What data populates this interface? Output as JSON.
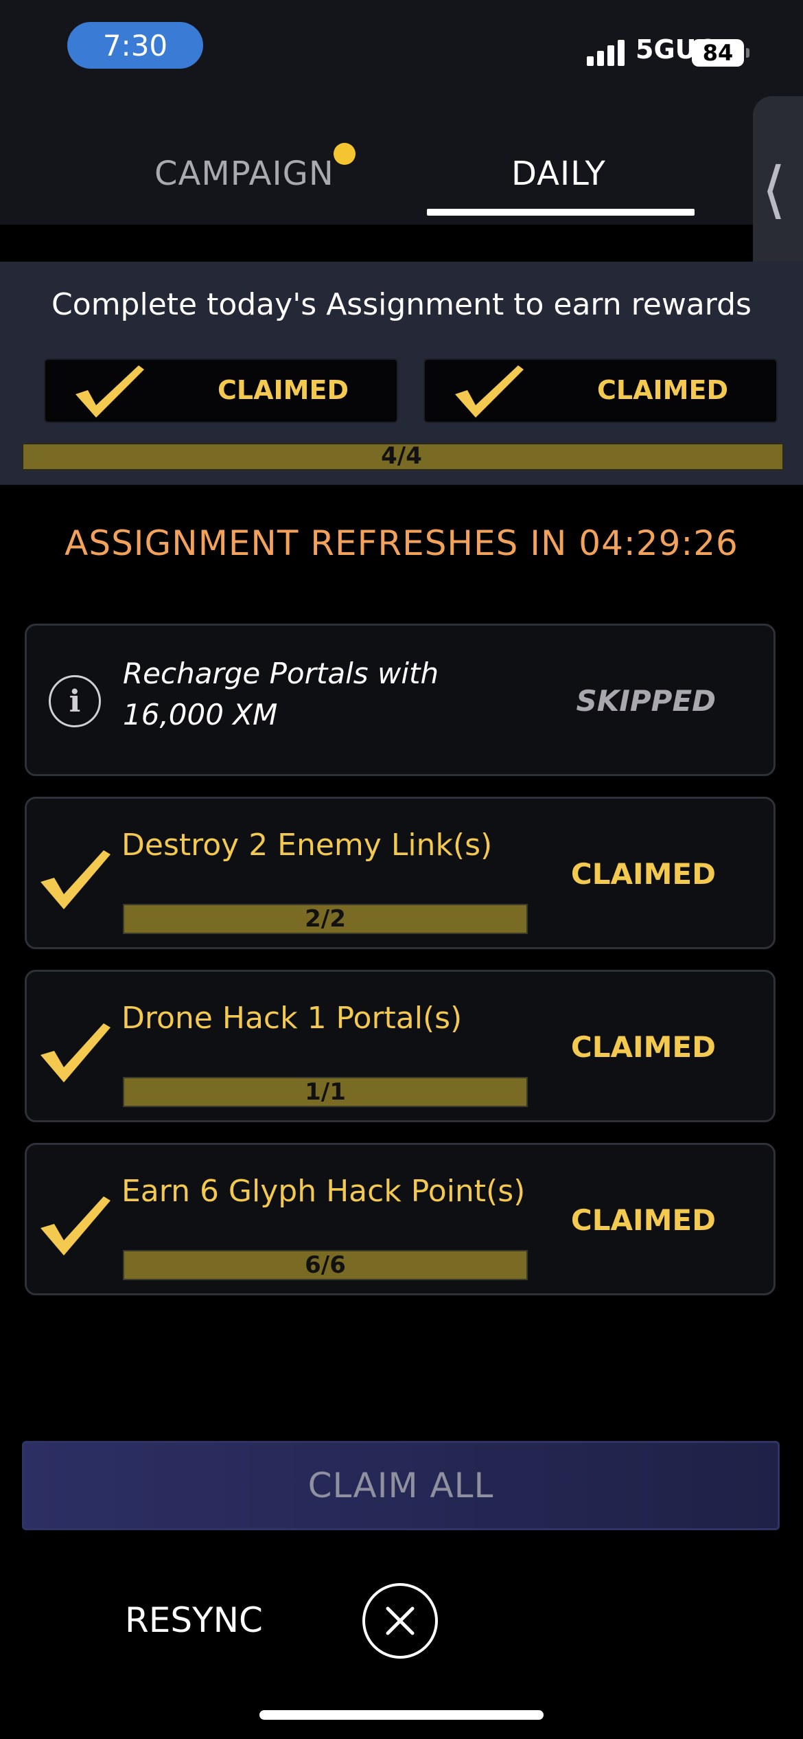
{
  "status_bar": {
    "time": "7:30",
    "network": "5GUC",
    "battery": "84"
  },
  "tabs": [
    {
      "label": "CAMPAIGN",
      "active": false,
      "has_notification": true
    },
    {
      "label": "DAILY",
      "active": true
    }
  ],
  "rewards": {
    "title": "Complete today's Assignment to earn rewards",
    "boxes": [
      {
        "label": "CLAIMED"
      },
      {
        "label": "CLAIMED"
      }
    ],
    "progress_text": "4/4",
    "progress": 1.0
  },
  "refresh_text": "ASSIGNMENT REFRESHES IN 04:29:26",
  "tasks": [
    {
      "title": "Recharge Portals with 16,000 XM",
      "status": "SKIPPED"
    },
    {
      "title": "Destroy 2 Enemy Link(s)",
      "status": "CLAIMED",
      "progress_text": "2/2",
      "progress": 1.0
    },
    {
      "title": "Drone Hack 1 Portal(s)",
      "status": "CLAIMED",
      "progress_text": "1/1",
      "progress": 1.0
    },
    {
      "title": "Earn 6 Glyph Hack Point(s)",
      "status": "CLAIMED",
      "progress_text": "6/6",
      "progress": 1.0
    }
  ],
  "buttons": {
    "claim_all": "CLAIM ALL",
    "resync": "RESYNC"
  },
  "icons": {
    "check": "checkmark-icon",
    "info": "info-icon",
    "close": "close-icon",
    "back": "chevron-left-icon"
  },
  "colors": {
    "accent_gold": "#f4c94f",
    "refresh_orange": "#f2a25a",
    "bar_fill": "#7a6b24",
    "claim_all_bg": "#2c2f63"
  }
}
